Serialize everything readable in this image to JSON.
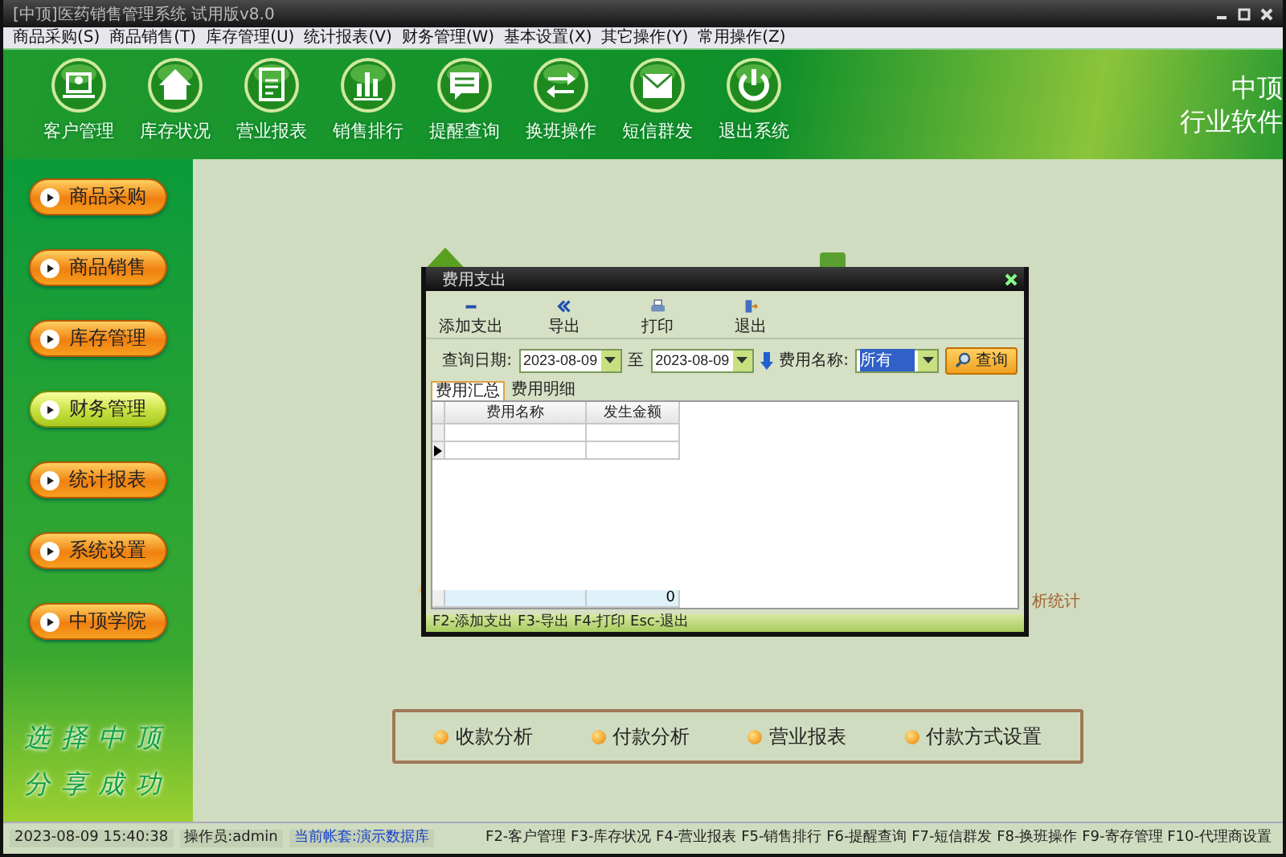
{
  "window": {
    "title": "[中顶]医药销售管理系统 试用版v8.0"
  },
  "menu": [
    "商品采购(S)",
    "商品销售(T)",
    "库存管理(U)",
    "统计报表(V)",
    "财务管理(W)",
    "基本设置(X)",
    "其它操作(Y)",
    "常用操作(Z)"
  ],
  "toolbar": [
    {
      "label": "客户管理",
      "kind": "person"
    },
    {
      "label": "库存状况",
      "kind": "house"
    },
    {
      "label": "营业报表",
      "kind": "document"
    },
    {
      "label": "销售排行",
      "kind": "chart"
    },
    {
      "label": "提醒查询",
      "kind": "bubble"
    },
    {
      "label": "换班操作",
      "kind": "swap"
    },
    {
      "label": "短信群发",
      "kind": "envelope"
    },
    {
      "label": "退出系统",
      "kind": "power"
    }
  ],
  "brand": {
    "line_1": "中顶",
    "line_2": "行业软件"
  },
  "sidebar": {
    "items": [
      {
        "label": "商品采购",
        "selected": false
      },
      {
        "label": "商品销售",
        "selected": false
      },
      {
        "label": "库存管理",
        "selected": false
      },
      {
        "label": "财务管理",
        "selected": true
      },
      {
        "label": "统计报表",
        "selected": false
      },
      {
        "label": "系统设置",
        "selected": false
      },
      {
        "label": "中顶学院",
        "selected": false
      }
    ],
    "slogan": [
      "选择中顶",
      "分享成功"
    ]
  },
  "partial_label": "析统计",
  "function_buttons": [
    "收款分析",
    "付款分析",
    "营业报表",
    "付款方式设置"
  ],
  "dialog": {
    "title": "费用支出",
    "toolbar": [
      {
        "label": "添加支出",
        "kind": "minus"
      },
      {
        "label": "导出",
        "kind": "chevrons"
      },
      {
        "label": "打印",
        "kind": "printer"
      },
      {
        "label": "退出",
        "kind": "exit"
      }
    ],
    "filter": {
      "date_label": "查询日期:",
      "date_from": "2023-08-09",
      "to_label": "至",
      "date_to": "2023-08-09",
      "name_label": "费用名称:",
      "name_value": "所有",
      "query_button": "查询"
    },
    "tabs": [
      {
        "label": "费用汇总",
        "selected": true
      },
      {
        "label": "费用明细",
        "selected": false
      }
    ],
    "table": {
      "columns": [
        "费用名称",
        "发生金额"
      ],
      "rows": [
        {
          "current": false
        },
        {
          "current": true
        }
      ],
      "total": "0"
    },
    "hint": "F2-添加支出 F3-导出 F4-打印 Esc-退出"
  },
  "status_bar": {
    "time": "2023-08-09 15:40:38",
    "operator": "操作员:admin",
    "account": "当前帐套:演示数据库",
    "shortcuts": "F2-客户管理 F3-库存状况 F4-营业报表 F5-销售排行 F6-提醒查询 F7-短信群发 F8-换班操作 F9-寄存管理 F10-代理商设置"
  }
}
